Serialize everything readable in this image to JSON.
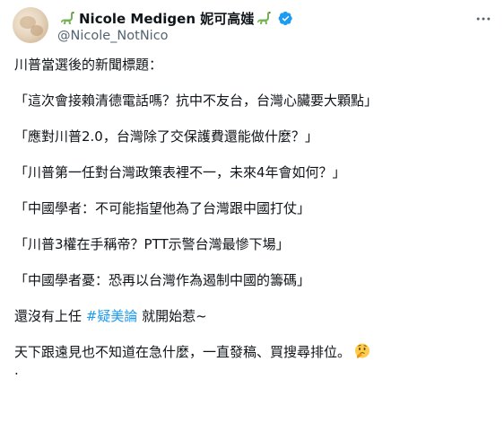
{
  "author": {
    "display_name": "Nicole Medigen 妮可高媸",
    "handle": "@Nicole_NotNico"
  },
  "tweet": {
    "intro": "川普當選後的新聞標題：",
    "headlines": [
      "「這次會接賴清德電話嗎？抗中不友台，台灣心臟要大顆點」",
      "「應對川普2.0，台灣除了交保護費還能做什麼？」",
      "「川普第一任對台灣政策表裡不一，未來4年會如何？」",
      "「中國學者：不可能指望他為了台灣跟中國打仗」",
      "「川普3權在手稱帝？PTT示警台灣最慘下場」",
      "「中國學者憂：恐再以台灣作為遏制中國的籌碼」"
    ],
    "pre_hashtag": "還沒有上任 ",
    "hashtag": "#疑美論",
    "post_hashtag": " 就開始惹~",
    "closing": "天下跟遠見也不知道在急什麼，一直發稿、買搜尋排位。",
    "trailing": "."
  },
  "icons": {
    "dino": "sauropod-emoji",
    "verified": "verified-badge-icon",
    "more": "more-options-icon",
    "thinking": "thinking-face-emoji"
  },
  "colors": {
    "text": "#0f1419",
    "secondary": "#536471",
    "accent": "#1d9bf0"
  }
}
